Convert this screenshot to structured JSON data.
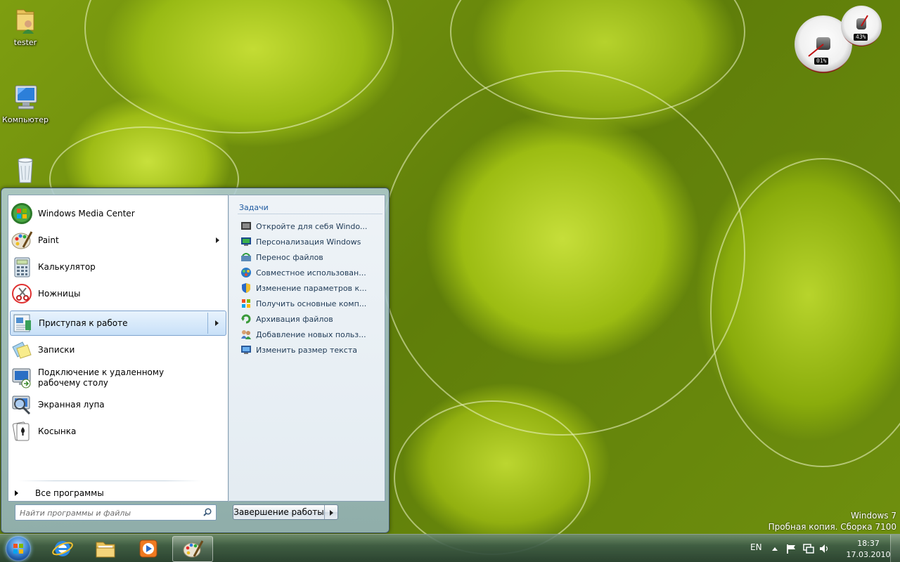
{
  "desktop": {
    "icons": [
      {
        "label": "tester",
        "icon": "user-folder-icon"
      },
      {
        "label": "Компьютер",
        "icon": "computer-icon"
      },
      {
        "label": "",
        "icon": "recycle-bin-icon"
      }
    ],
    "watermark": {
      "line1": "Windows 7",
      "line2": "Пробная копия. Сборка 7100"
    }
  },
  "gadget": {
    "cpu_readout": "01%",
    "memory_readout": "43%",
    "cpu_value": 0.01,
    "memory_value": 0.43
  },
  "start_menu": {
    "programs": [
      {
        "label": "Windows Media Center",
        "icon": "windows-media-center-icon",
        "submenu": false
      },
      {
        "label": "Paint",
        "icon": "paint-icon",
        "submenu": true
      },
      {
        "label": "Калькулятор",
        "icon": "calculator-icon",
        "submenu": false
      },
      {
        "label": "Ножницы",
        "icon": "snipping-tool-icon",
        "submenu": false
      },
      {
        "label": "Приступая к работе",
        "icon": "getting-started-icon",
        "submenu": true,
        "selected": true
      },
      {
        "label": "Записки",
        "icon": "sticky-notes-icon",
        "submenu": false
      },
      {
        "label": "Подключение к удаленному рабочему столу",
        "icon": "remote-desktop-icon",
        "submenu": false
      },
      {
        "label": "Экранная лупа",
        "icon": "magnifier-icon",
        "submenu": false
      },
      {
        "label": "Косынка",
        "icon": "solitaire-icon",
        "submenu": false
      }
    ],
    "all_programs_label": "Все программы",
    "tasks_header": "Задачи",
    "tasks": [
      {
        "label": "Откройте для себя Windo...",
        "icon": "discover-windows-icon"
      },
      {
        "label": "Персонализация Windows",
        "icon": "personalize-icon"
      },
      {
        "label": "Перенос файлов",
        "icon": "transfer-files-icon"
      },
      {
        "label": "Совместное использован...",
        "icon": "homegroup-icon"
      },
      {
        "label": "Изменение параметров к...",
        "icon": "uac-shield-icon"
      },
      {
        "label": "Получить основные комп...",
        "icon": "windows-flag-icon"
      },
      {
        "label": "Архивация файлов",
        "icon": "backup-icon"
      },
      {
        "label": "Добавление новых польз...",
        "icon": "add-users-icon"
      },
      {
        "label": "Изменить размер текста",
        "icon": "text-size-icon"
      }
    ],
    "search_placeholder": "Найти программы и файлы",
    "shutdown_label": "Завершение работы"
  },
  "taskbar": {
    "pinned": [
      {
        "name": "internet-explorer",
        "icon": "internet-explorer-icon",
        "active": false
      },
      {
        "name": "windows-explorer",
        "icon": "folder-icon",
        "active": false
      },
      {
        "name": "media-player",
        "icon": "media-player-icon",
        "active": false
      },
      {
        "name": "paint",
        "icon": "paint-icon",
        "active": true
      }
    ],
    "tray": {
      "language": "EN",
      "time": "18:37",
      "date": "17.03.2010"
    }
  },
  "colors": {
    "accent": "#1e5aa0",
    "selection_border": "#7da2ce",
    "wallpaper_green": "#9cbc12"
  }
}
